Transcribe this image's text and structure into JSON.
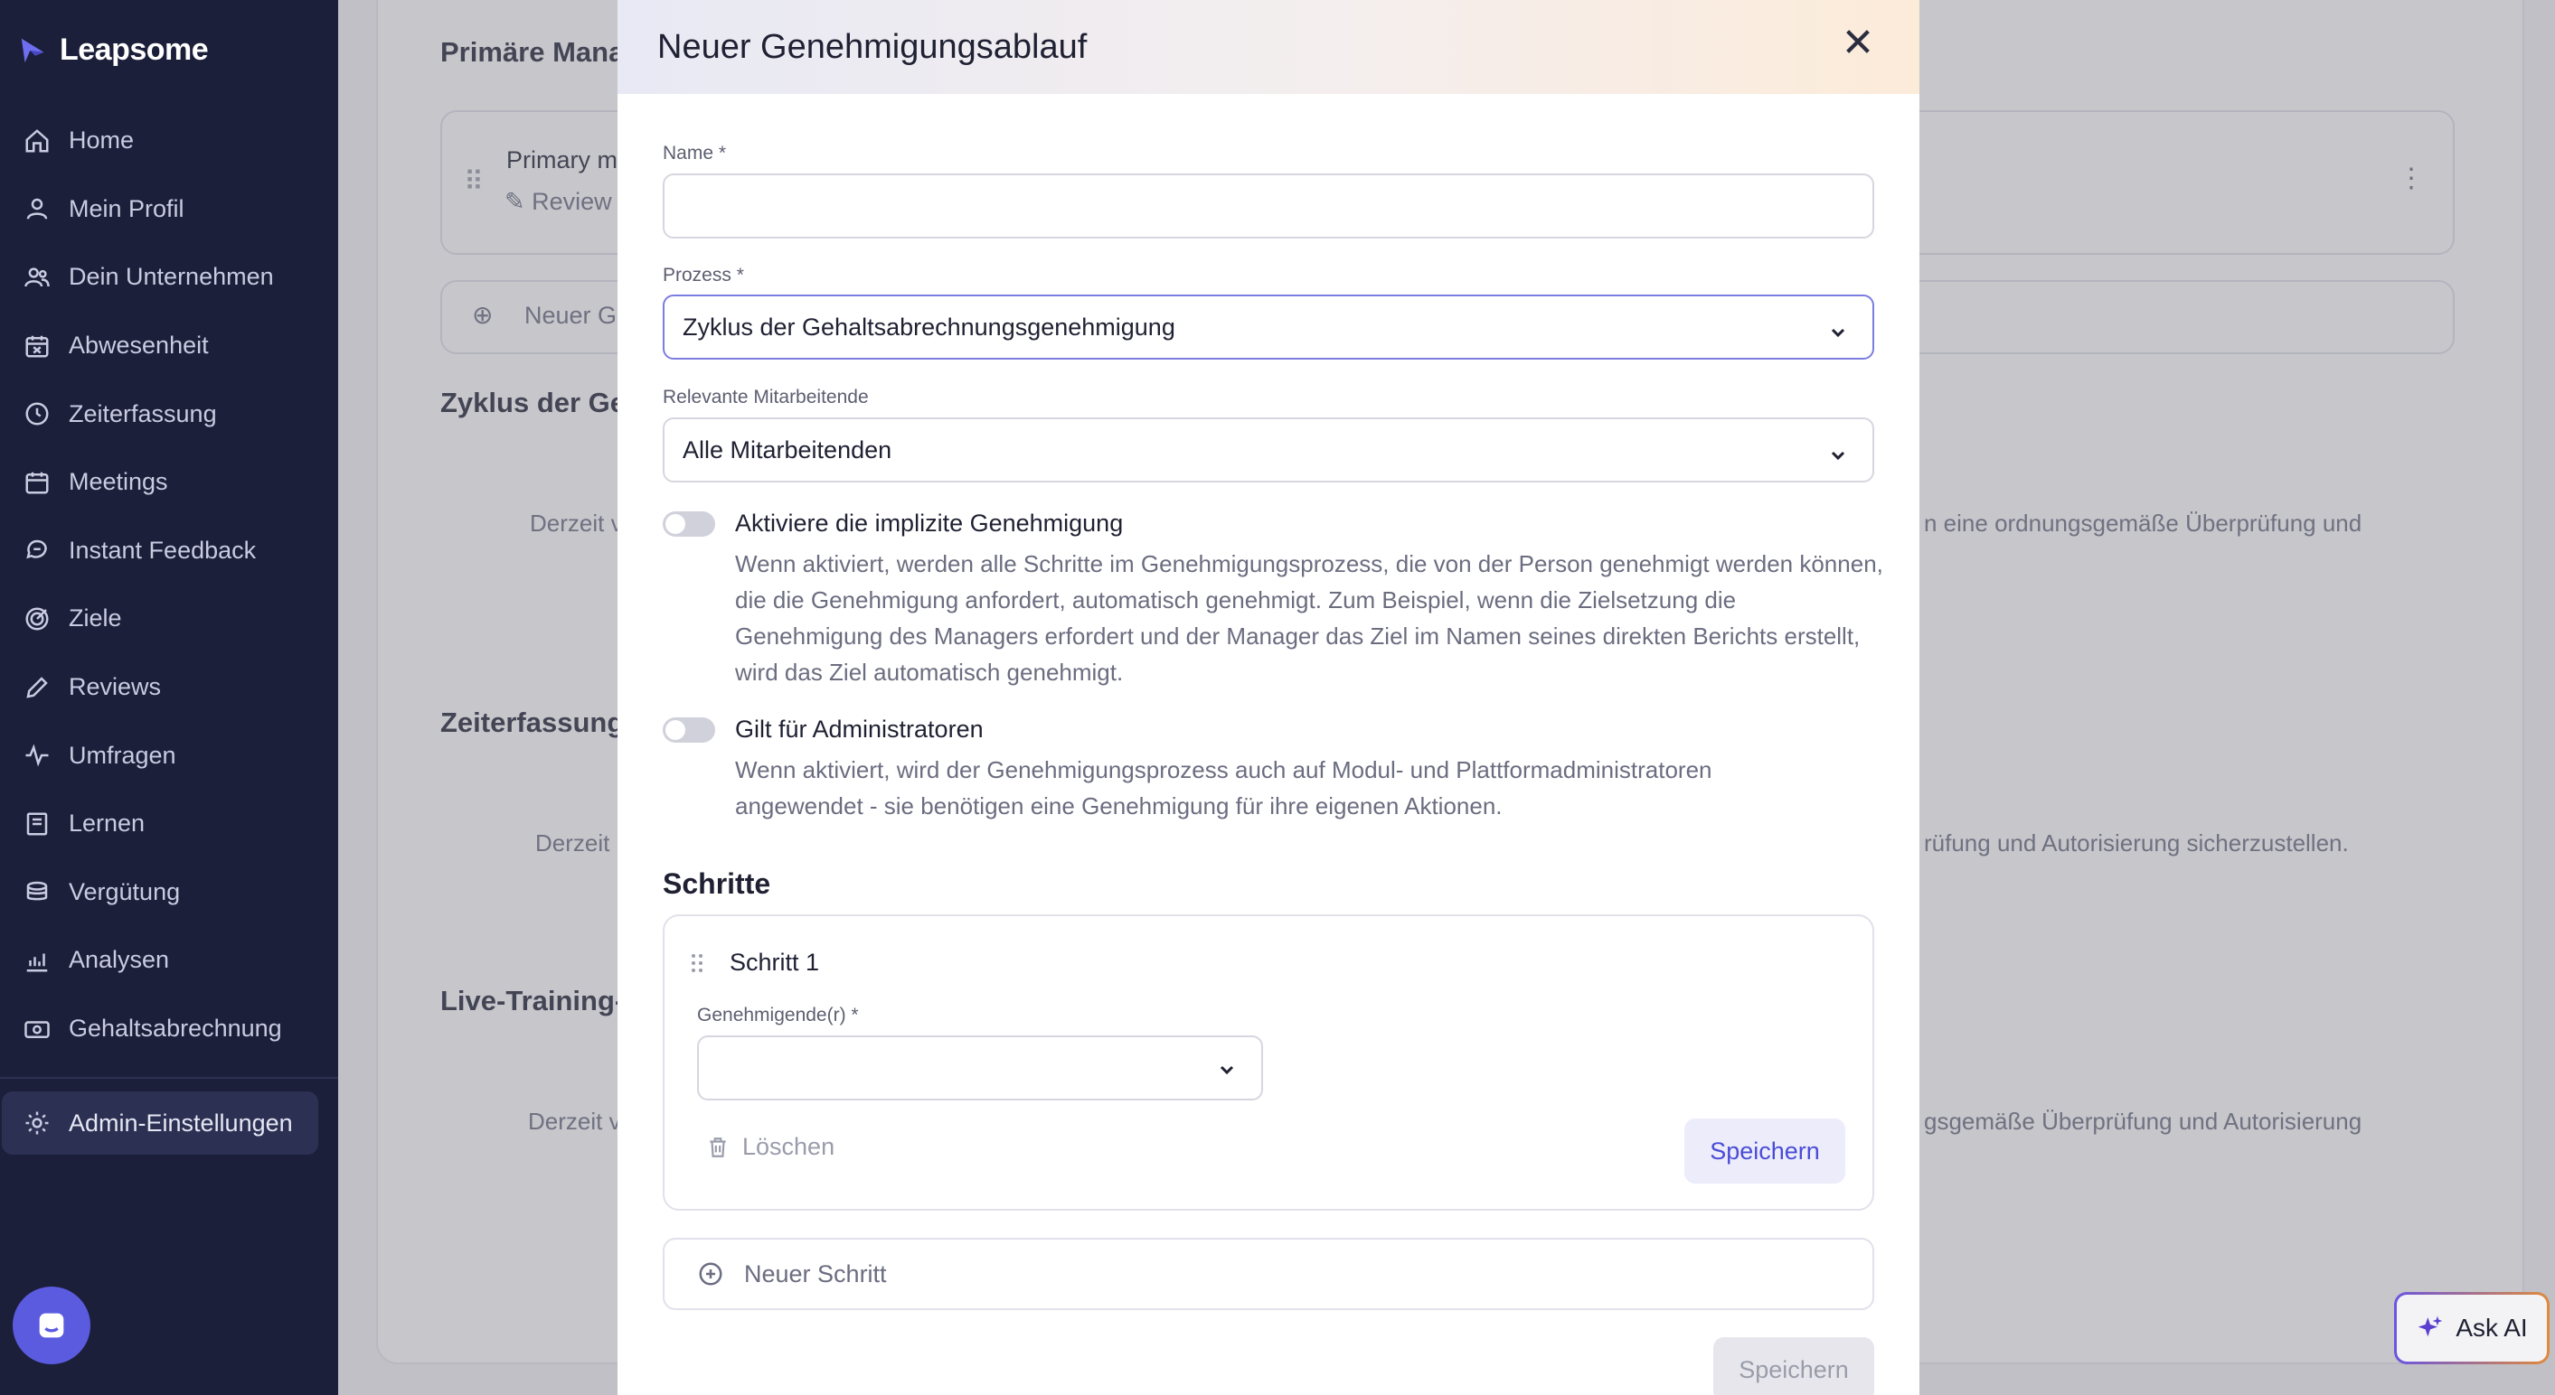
{
  "app": {
    "brand": "Leapsome"
  },
  "sidebar": {
    "items": [
      {
        "label": "Home",
        "icon": "home-icon"
      },
      {
        "label": "Mein Profil",
        "icon": "user-icon"
      },
      {
        "label": "Dein Unternehmen",
        "icon": "users-icon"
      },
      {
        "label": "Abwesenheit",
        "icon": "calendar-x-icon"
      },
      {
        "label": "Zeiterfassung",
        "icon": "clock-icon"
      },
      {
        "label": "Meetings",
        "icon": "calendar-icon"
      },
      {
        "label": "Instant Feedback",
        "icon": "chat-icon"
      },
      {
        "label": "Ziele",
        "icon": "target-icon"
      },
      {
        "label": "Reviews",
        "icon": "pen-icon"
      },
      {
        "label": "Umfragen",
        "icon": "pulse-icon"
      },
      {
        "label": "Lernen",
        "icon": "book-icon"
      },
      {
        "label": "Vergütung",
        "icon": "coins-icon"
      },
      {
        "label": "Analysen",
        "icon": "chart-icon"
      },
      {
        "label": "Gehaltsabrechnung",
        "icon": "cash-icon"
      }
    ],
    "admin": {
      "label": "Admin-Einstellungen",
      "icon": "gear-icon"
    }
  },
  "background": {
    "section1_title": "Primäre Mana",
    "row1_title": "Primary ma",
    "row1_sub": "Review",
    "new_flow": "Neuer G",
    "section2_title": "Zyklus der Ge",
    "section2_text_left": "Derzeit v",
    "section2_text_right": "n eine ordnungsgemäße Überprüfung und",
    "section3_title": "Zeiterfassung",
    "section3_text_left": "Derzeit",
    "section3_text_right": "rüfung und Autorisierung sicherzustellen.",
    "section4_title": "Live-Training-",
    "section4_text_left": "Derzeit v",
    "section4_text_right": "gsgemäße Überprüfung und Autorisierung"
  },
  "modal": {
    "title": "Neuer Genehmigungsablauf",
    "name_label": "Name *",
    "name_value": "",
    "process_label": "Prozess *",
    "process_value": "Zyklus der Gehaltsabrechnungsgenehmigung",
    "employees_label": "Relevante Mitarbeitende",
    "employees_value": "Alle Mitarbeitenden",
    "implicit_toggle": {
      "title": "Aktiviere die implizite Genehmigung",
      "desc": "Wenn aktiviert, werden alle Schritte im Genehmigungsprozess, die von der Person genehmigt werden können, die die Genehmigung anfordert, automatisch genehmigt. Zum Beispiel, wenn die Zielsetzung die Genehmigung des Managers erfordert und der Manager das Ziel im Namen seines direkten Berichts erstellt, wird das Ziel automatisch genehmigt.",
      "enabled": false
    },
    "admin_toggle": {
      "title": "Gilt für Administratoren",
      "desc": "Wenn aktiviert, wird der Genehmigungsprozess auch auf Modul- und Plattformadministratoren angewendet - sie benötigen eine Genehmigung für ihre eigenen Aktionen.",
      "enabled": false
    },
    "steps_title": "Schritte",
    "step": {
      "title": "Schritt 1",
      "approver_label": "Genehmigende(r) *",
      "approver_value": "",
      "delete_label": "Löschen",
      "save_label": "Speichern"
    },
    "new_step_label": "Neuer Schritt",
    "footer_save_label": "Speichern"
  },
  "ask_ai": {
    "label": "Ask AI"
  },
  "colors": {
    "sidebar_bg": "#1c1f3a",
    "accent": "#4a4cd6",
    "focus_border": "#7b7de0"
  }
}
